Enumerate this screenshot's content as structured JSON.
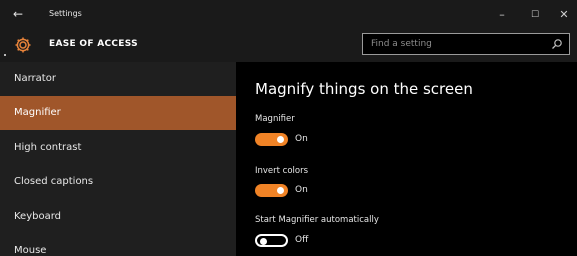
{
  "titlebar": {
    "title": "Settings",
    "back_glyph": "←",
    "minimize_glyph": "–",
    "maximize_glyph": "☐",
    "close_glyph": "✕"
  },
  "header": {
    "section_title": "EASE OF ACCESS",
    "search_placeholder": "Find a setting",
    "icon": "gear-icon",
    "icon_color": "#e8833a"
  },
  "sidebar": {
    "items": [
      {
        "label": "Narrator"
      },
      {
        "label": "Magnifier",
        "active": true
      },
      {
        "label": "High contrast"
      },
      {
        "label": "Closed captions"
      },
      {
        "label": "Keyboard"
      },
      {
        "label": "Mouse"
      }
    ],
    "active_color": "#a0562a"
  },
  "main": {
    "page_title": "Magnify things on the screen",
    "settings": [
      {
        "label": "Magnifier",
        "state": "On",
        "on": true
      },
      {
        "label": "Invert colors",
        "state": "On",
        "on": true
      },
      {
        "label": "Start Magnifier automatically",
        "state": "Off",
        "on": false
      }
    ],
    "accent_color": "#f08326"
  }
}
